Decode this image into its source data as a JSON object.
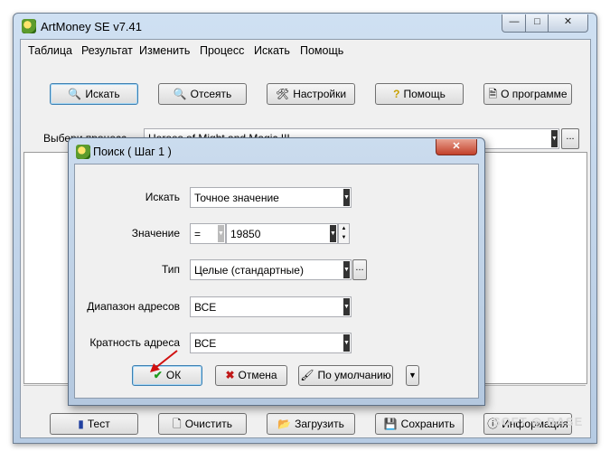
{
  "window": {
    "title": "ArtMoney SE v7.41"
  },
  "title_buttons": {
    "minimize": "—",
    "maximize": "□",
    "close": "✕"
  },
  "menu": [
    "Таблица",
    "Результат",
    "Изменить",
    "Процесс",
    "Искать",
    "Помощь"
  ],
  "toolbar": {
    "search": "Искать",
    "filter": "Отсеять",
    "settings": "Настройки",
    "help": "Помощь",
    "about": "О программе"
  },
  "process": {
    "label": "Выбери процесс",
    "value": "Heroes of Might and Magic III",
    "more": "..."
  },
  "bottom_buttons": {
    "test": "Тест",
    "clear": "Очистить",
    "load": "Загрузить",
    "save": "Сохранить",
    "info": "Информация"
  },
  "dialog": {
    "title": "Поиск ( Шаг 1 )",
    "close": "✕",
    "search_label": "Искать",
    "search_value": "Точное значение",
    "value_label": "Значение",
    "value_operator": "=",
    "value_input": "19850",
    "type_label": "Тип",
    "type_value": "Целые (стандартные)",
    "type_more": "...",
    "range_label": "Диапазон адресов",
    "range_value": "ВСЕ",
    "align_label": "Кратность адреса",
    "align_value": "ВСЕ",
    "ok": "ОК",
    "cancel": "Отмена",
    "default": "По умолчанию"
  },
  "watermark": "SOFT ◎ BASE",
  "colors": {
    "accent_focus": "#3c7fb1",
    "titlebar": "#b6cbe3",
    "close_red": "#c2412a",
    "arrow_red": "#d01010"
  }
}
